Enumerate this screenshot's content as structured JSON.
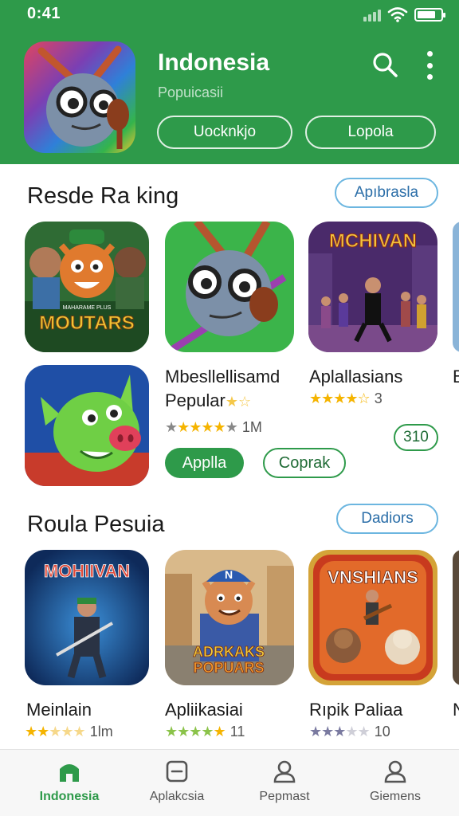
{
  "status": {
    "time": "0:41"
  },
  "header": {
    "title": "Indonesia",
    "subtitle": "Popuicasii",
    "btn1": "Uocknkjo",
    "btn2": "Lopola"
  },
  "section1": {
    "title": "Resde Ra king",
    "pill": "Apıbrasla",
    "apps": [
      {
        "name": "Mbesllellisamd",
        "name2": "Pepular",
        "rating_text": "★★★★★",
        "count": "1M"
      },
      {
        "name": "Aplallasians",
        "rating_text": "★★★★☆",
        "count": "3"
      }
    ],
    "right_badge": "310",
    "apply_label": "Applla",
    "outline_label": "Coprak",
    "poster1_line1": "MAHARAME PLUS",
    "poster1_line2": "MOUTARS",
    "poster2_line1": "MCHIVAN"
  },
  "section2": {
    "title": "Roula Pesuia",
    "pill": "Dadiors",
    "apps": [
      {
        "name": "Meinlain",
        "count": "1lm"
      },
      {
        "name": "Apliikasiai",
        "count": "11"
      },
      {
        "name": "Rıpik Paliaa",
        "count": "10"
      }
    ],
    "poster1": "MOHIIVAN",
    "poster2_l1": "ADRKAKS",
    "poster2_l2": "POPUARS",
    "poster3": "VNSHIANS",
    "cap_letter": "N"
  },
  "nav": [
    {
      "label": "Indonesia"
    },
    {
      "label": "Aplakcsia"
    },
    {
      "label": "Pepmast"
    },
    {
      "label": "Giemens"
    }
  ],
  "colors": {
    "primary": "#2e9a4a",
    "accent_blue": "#6cb6e0",
    "star": "#f5b400"
  }
}
